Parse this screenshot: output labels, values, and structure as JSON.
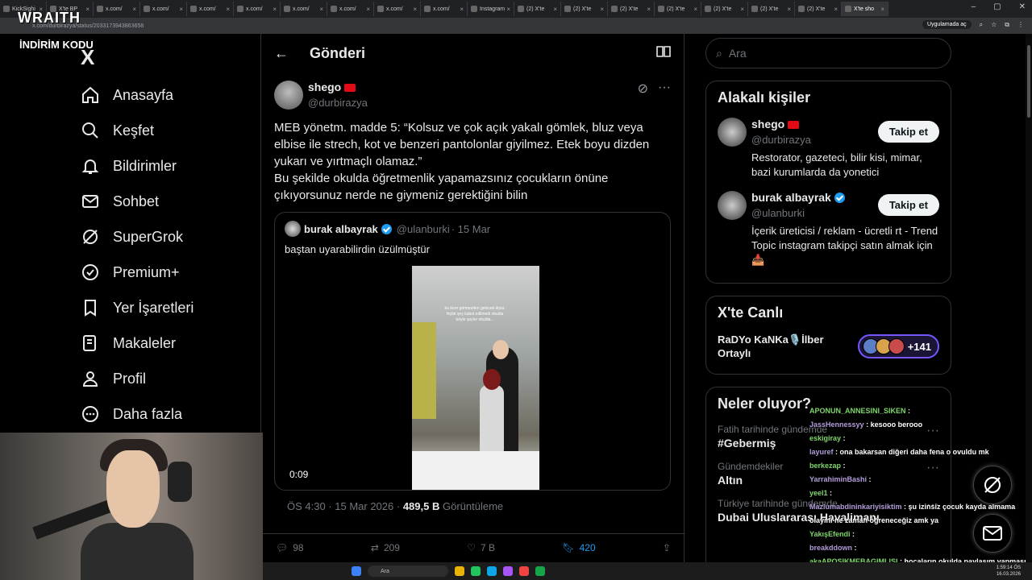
{
  "browser": {
    "tabs": [
      "KickSighi",
      "X'te BP",
      "x.com/",
      "x.com/",
      "x.com/",
      "x.com/",
      "x.com/",
      "x.com/",
      "x.com/",
      "x.com/",
      "Instagram",
      "(2) X'te",
      "(2) X'te",
      "(2) X'te",
      "(2) X'te",
      "(2) X'te",
      "(2) X'te",
      "(2) X'te",
      "X'te sho"
    ],
    "active_tab_index": 18,
    "url": "x.com/durbirazya/status/2033173943863658",
    "app_chip": "Uygulamada aç"
  },
  "overlay": {
    "brand": "WRAITH",
    "promo": "İNDİRİM KODU"
  },
  "nav": {
    "logo": "X",
    "items": [
      {
        "label": "Anasayfa",
        "icon": "home-icon"
      },
      {
        "label": "Keşfet",
        "icon": "search-icon"
      },
      {
        "label": "Bildirimler",
        "icon": "bell-icon"
      },
      {
        "label": "Sohbet",
        "icon": "mail-icon"
      },
      {
        "label": "SuperGrok",
        "icon": "grok-icon"
      },
      {
        "label": "Premium+",
        "icon": "verified-icon"
      },
      {
        "label": "Yer İşaretleri",
        "icon": "bookmark-icon"
      },
      {
        "label": "Makaleler",
        "icon": "article-icon"
      },
      {
        "label": "Profil",
        "icon": "profile-icon"
      },
      {
        "label": "Daha fazla",
        "icon": "more-icon"
      }
    ]
  },
  "main": {
    "title": "Gönderi",
    "post": {
      "name": "shego",
      "handle": "@durbirazya",
      "text": "MEB yönetm. madde 5: “Kolsuz ve çok açık yakalı gömlek, bluz veya elbise ile strech, kot ve benzeri pantolonlar giyilmez. Etek boyu dizden yukarı ve yırtmaçlı olamaz.”\nBu şekilde okulda öğretmenlik yapamazsınız çocukların önüne çıkıyorsunuz nerde ne giymeniz gerektiğini bilin",
      "quote": {
        "name": "burak albayrak",
        "handle": "@ulanburki",
        "date": "· 15 Mar",
        "text": "baştan uyarabilirdin üzülmüştür",
        "video_time": "0:09",
        "video_caption": "bu kere görmezden gelecek diyor. hiçbir şey kabul edilmedi okulda böyle şeyler okulda..."
      },
      "time": "ÖS 4:30 · 15 Mar 2026 ·",
      "views": "489,5 B",
      "views_label": "Görüntüleme",
      "stats": {
        "replies": "98",
        "reposts": "209",
        "likes": "7 B",
        "bookmarks": "420"
      }
    }
  },
  "right": {
    "search_placeholder": "Ara",
    "related_title": "Alakalı kişiler",
    "people": [
      {
        "name": "shego",
        "handle": "@durbirazya",
        "bio": "Restorator, gazeteci, bilir kisi, mimar, bazi kurumlarda da yonetici",
        "follow": "Takip et"
      },
      {
        "name": "burak albayrak",
        "handle": "@ulanburki",
        "bio": "İçerik üreticisi / reklam - ücretli rt - Trend Topic instagram takipçi satın almak için 📥",
        "follow": "Takip et"
      }
    ],
    "live_title": "X'te Canlı",
    "live_name": "RaDYo KaNKa🎙️İlber Ortaylı",
    "live_count": "+141",
    "trends_title": "Neler oluyor?",
    "trends": [
      {
        "context": "Fatih tarihinde gündemde",
        "topic": "#Gebermiş"
      },
      {
        "context": "Gündemdekiler",
        "topic": "Altın"
      },
      {
        "context": "Türkiye tarihinde gündemde",
        "topic": "Dubai Uluslararası Havalimanı"
      }
    ]
  },
  "chat": [
    {
      "user": "APONUN_ANNESINI_SIKEN",
      "msg": ":"
    },
    {
      "user": "JassHennessyy",
      "msg": ": kesooo berooo"
    },
    {
      "user": "eskigiray",
      "msg": ":"
    },
    {
      "user": "layuref",
      "msg": ": ona bakarsan diğeri daha fena o ovuldu mk"
    },
    {
      "user": "berkezap",
      "msg": ":"
    },
    {
      "user": "YarrahiminBashi",
      "msg": ":"
    },
    {
      "user": "yeel1",
      "msg": ":"
    },
    {
      "user": "Mazlumabdininkariyisiktim",
      "msg": ": şu izinsiz çocuk kayda almama olayını ne zaman öğreneceğiz amk ya"
    },
    {
      "user": "YakışEfendi",
      "msg": ":"
    },
    {
      "user": "breakddown",
      "msg": ":"
    },
    {
      "user": "akaAPOSIKMEBAGIMLISI",
      "msg": ": hocaların okulda paylaşım yapması yasaklanmalı"
    }
  ],
  "taskbar": {
    "search": "Ara",
    "time": "1:59:14 ÖS",
    "date": "16.03.2026"
  }
}
